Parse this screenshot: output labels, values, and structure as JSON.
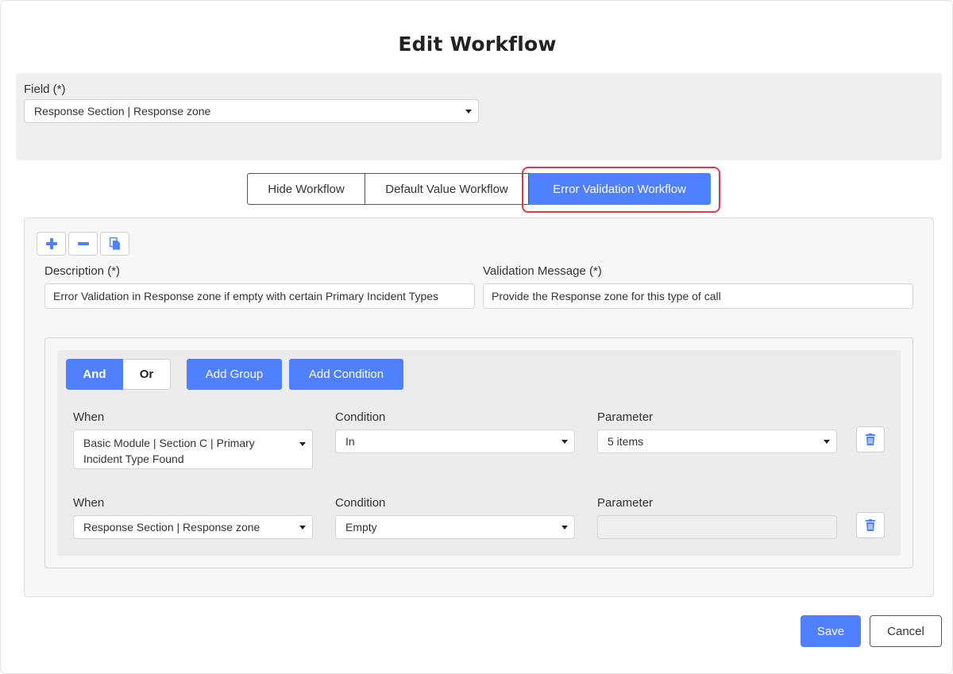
{
  "dialog": {
    "title": "Edit Workflow"
  },
  "field": {
    "label": "Field (*)",
    "value": "Response Section | Response zone"
  },
  "tabs": [
    {
      "label": "Hide Workflow",
      "active": false
    },
    {
      "label": "Default Value Workflow",
      "active": false
    },
    {
      "label": "Error Validation Workflow",
      "active": true
    }
  ],
  "toolbar": {
    "add_icon": "plus-icon",
    "remove_icon": "minus-icon",
    "copy_icon": "copy-icon"
  },
  "description": {
    "label": "Description (*)",
    "value": "Error Validation in Response zone if empty with certain Primary Incident Types"
  },
  "validation_message": {
    "label": "Validation Message (*)",
    "value": "Provide the Response zone for this type of call"
  },
  "group": {
    "and_label": "And",
    "or_label": "Or",
    "add_group_label": "Add Group",
    "add_condition_label": "Add Condition",
    "conditions": [
      {
        "when_label": "When",
        "when_value": "Basic Module | Section C | Primary Incident Type Found",
        "condition_label": "Condition",
        "condition_value": "In",
        "parameter_label": "Parameter",
        "parameter_value": "5 items"
      },
      {
        "when_label": "When",
        "when_value": "Response Section | Response zone",
        "condition_label": "Condition",
        "condition_value": "Empty",
        "parameter_label": "Parameter",
        "parameter_value": ""
      }
    ]
  },
  "footer": {
    "save_label": "Save",
    "cancel_label": "Cancel"
  },
  "colors": {
    "primary": "#4f80ff",
    "highlight": "#e0364a",
    "panel": "#efefef"
  }
}
